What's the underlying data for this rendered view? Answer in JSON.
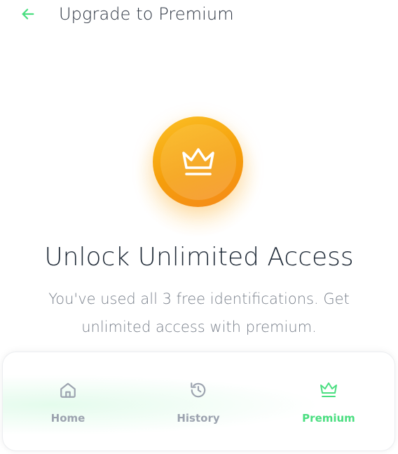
{
  "header": {
    "title": "Upgrade to Premium",
    "back_icon": "arrow-left-icon"
  },
  "hero": {
    "icon": "crown-icon",
    "headline": "Unlock Unlimited Access",
    "subtext": "You've used all 3 free identifications. Get unlimited access with premium."
  },
  "nav": {
    "items": [
      {
        "label": "Home",
        "icon": "home-icon",
        "active": false
      },
      {
        "label": "History",
        "icon": "history-icon",
        "active": false
      },
      {
        "label": "Premium",
        "icon": "crown-icon",
        "active": true
      }
    ]
  },
  "colors": {
    "accent": "#4ade80",
    "badge_start": "#fbbf24",
    "badge_end": "#f5891a",
    "inactive": "#9ca3af"
  }
}
